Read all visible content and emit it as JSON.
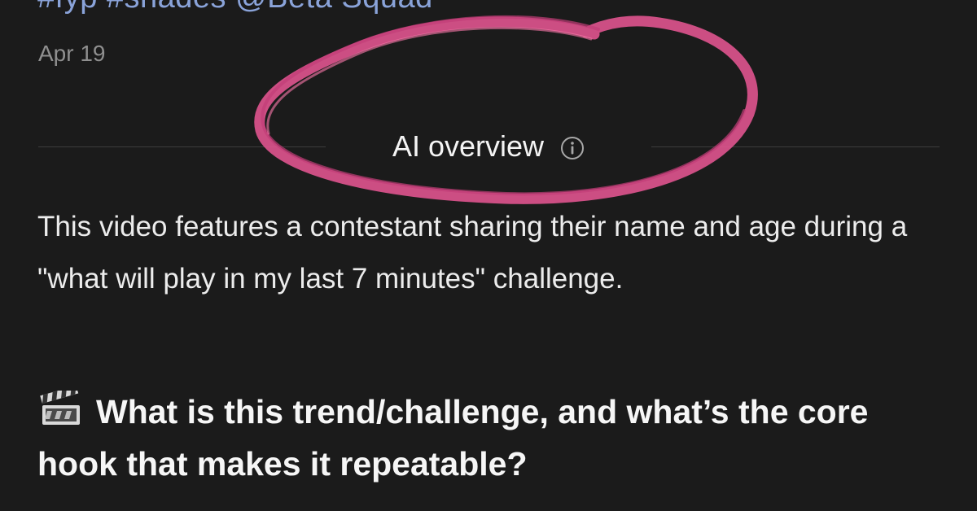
{
  "post": {
    "hashtags": "#fyp #shades @Beta Squad",
    "date": "Apr 19"
  },
  "ai_overview": {
    "title": "AI overview",
    "info_icon": "info-circle-icon",
    "summary": "This video features a contestant sharing their name and age during a \"what will play in my last 7 minutes\" challenge.",
    "question_icon": "clapper-board-icon",
    "question": "What is this trend/challenge, and what’s the core hook that makes it repeatable?"
  },
  "colors": {
    "background": "#1b1b1b",
    "hashtag": "#8aa3d9",
    "muted": "#8f8f8f",
    "highlight_scribble": "#e0548f"
  }
}
